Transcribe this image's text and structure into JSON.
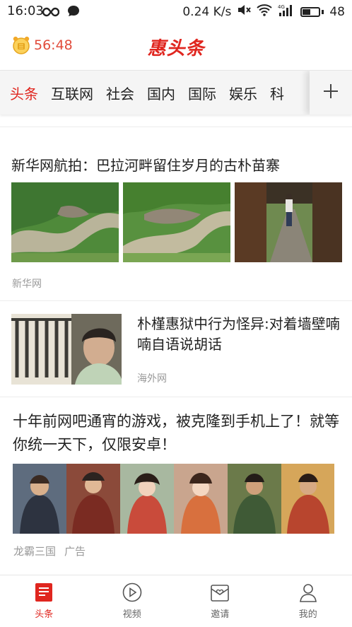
{
  "status_bar": {
    "time": "16:03",
    "net_speed": "0.24 K/s",
    "battery": "48",
    "icons": [
      "infinity-icon",
      "message-bubble-icon",
      "mute-icon",
      "wifi-icon",
      "signal-4g-icon",
      "battery-icon"
    ]
  },
  "header": {
    "timer": "56:48",
    "logo": "惠头条",
    "accent": "#e0261f"
  },
  "tabs": {
    "items": [
      "头条",
      "互联网",
      "社会",
      "国内",
      "国际",
      "娱乐",
      "科"
    ],
    "active_index": 0,
    "add_icon": "plus-icon"
  },
  "feed": {
    "articles": [
      {
        "title": "新华网航拍：巴拉河畔留住岁月的古朴苗寨",
        "source": "新华网"
      },
      {
        "title": "朴槿惠狱中行为怪异:对着墙壁喃喃自语说胡话",
        "source": "海外网"
      },
      {
        "title": "十年前网吧通宵的游戏，被克隆到手机上了！就等你统一天下，仅限安卓！",
        "source": "龙霸三国",
        "tag": "广告"
      }
    ]
  },
  "bottom_nav": {
    "items": [
      {
        "label": "头条",
        "icon": "news-icon"
      },
      {
        "label": "视频",
        "icon": "play-icon"
      },
      {
        "label": "邀请",
        "icon": "invite-heart-icon"
      },
      {
        "label": "我的",
        "icon": "user-icon"
      }
    ],
    "active_index": 0
  }
}
